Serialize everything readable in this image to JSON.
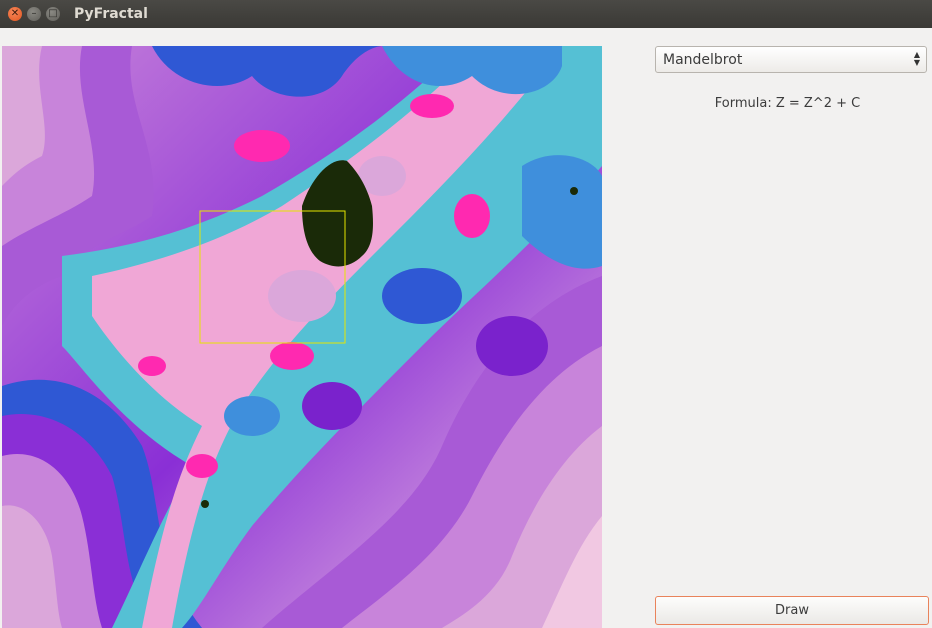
{
  "window": {
    "title": "PyFractal"
  },
  "controls": {
    "fractal_select": {
      "value": "Mandelbrot"
    },
    "formula": "Formula: Z = Z^2 + C",
    "draw_label": "Draw"
  },
  "colors": {
    "canvas_palette": [
      "#f1c8e2",
      "#dba7da",
      "#c884da",
      "#a85ad6",
      "#8a2fd6",
      "#7a22cc",
      "#2f58d4",
      "#3f8fdc",
      "#55c0d4",
      "#7edfd8",
      "#ff29b0",
      "#f0a7d6",
      "#1a2a08"
    ],
    "selection_rect": "#e6e600",
    "draw_button_border": "#e9835b"
  }
}
